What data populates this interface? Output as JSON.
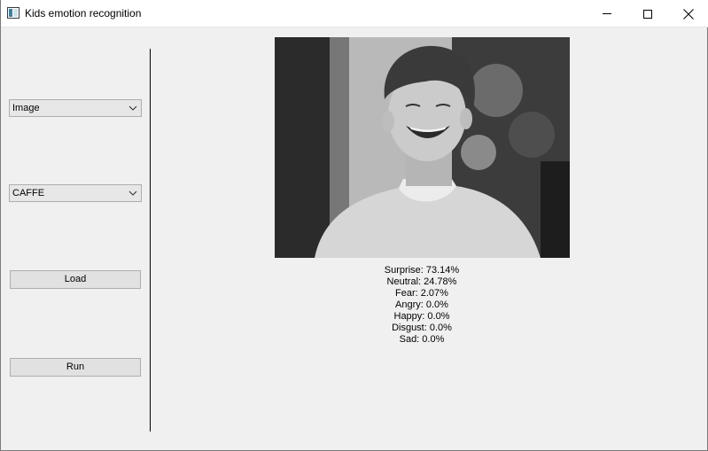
{
  "window": {
    "title": "Kids emotion recognition"
  },
  "controls": {
    "source_select": {
      "value": "Image"
    },
    "model_select": {
      "value": "CAFFE"
    },
    "load_label": "Load",
    "run_label": "Run"
  },
  "results": [
    "Surprise: 73.14%",
    "Neutral: 24.78%",
    "Fear: 2.07%",
    "Angry: 0.0%",
    "Happy: 0.0%",
    "Disgust: 0.0%",
    "Sad: 0.0%"
  ],
  "icons": {
    "app": "app-window-icon",
    "minimize": "minimize-icon",
    "maximize": "maximize-icon",
    "close": "close-icon",
    "dropdown": "chevron-down-icon"
  }
}
